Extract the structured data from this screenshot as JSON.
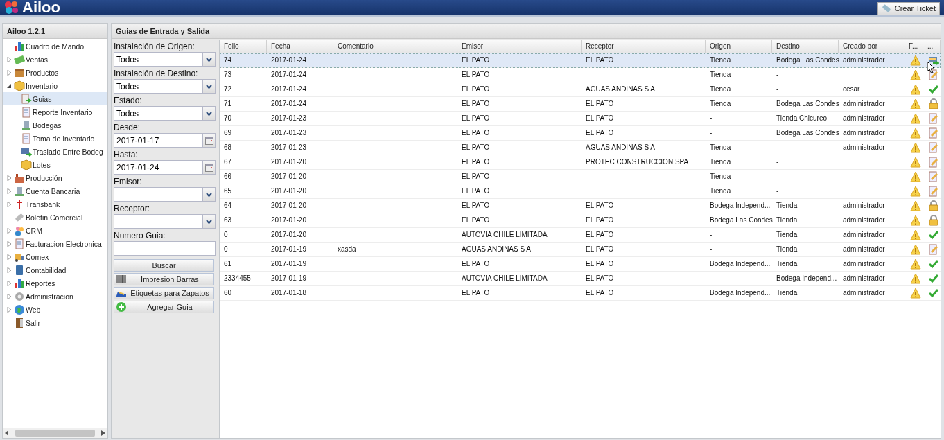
{
  "header": {
    "logo": "Ailoo",
    "ticket_button": "Crear Ticket"
  },
  "sidebar": {
    "title": "Ailoo 1.2.1",
    "items": [
      {
        "label": "Cuadro de Mando",
        "selected": false
      },
      {
        "label": "Ventas",
        "expanded": false,
        "selected": false
      },
      {
        "label": "Productos",
        "expanded": false,
        "selected": false
      },
      {
        "label": "Inventario",
        "expanded": true,
        "selected": false,
        "children": [
          {
            "label": "Guias",
            "selected": true
          },
          {
            "label": "Reporte Inventario",
            "selected": false
          },
          {
            "label": "Bodegas",
            "selected": false
          },
          {
            "label": "Toma de Inventario",
            "selected": false
          },
          {
            "label": "Traslado Entre Bodeg",
            "selected": false
          },
          {
            "label": "Lotes",
            "selected": false
          }
        ]
      },
      {
        "label": "Producción",
        "expanded": false,
        "selected": false
      },
      {
        "label": "Cuenta Bancaria",
        "expanded": false,
        "selected": false
      },
      {
        "label": "Transbank",
        "expanded": false,
        "selected": false
      },
      {
        "label": "Boletin Comercial",
        "selected": false
      },
      {
        "label": "CRM",
        "expanded": false,
        "selected": false
      },
      {
        "label": "Facturacion Electronica",
        "expanded": false,
        "selected": false
      },
      {
        "label": "Comex",
        "expanded": false,
        "selected": false
      },
      {
        "label": "Contabilidad",
        "expanded": false,
        "selected": false
      },
      {
        "label": "Reportes",
        "expanded": false,
        "selected": false
      },
      {
        "label": "Administracion",
        "expanded": false,
        "selected": false
      },
      {
        "label": "Web",
        "expanded": false,
        "selected": false
      },
      {
        "label": "Salir",
        "selected": false
      }
    ]
  },
  "main": {
    "title": "Guias de Entrada y Salida",
    "filters": [
      {
        "label": "Instalación de Origen:",
        "kind": "select",
        "value": "Todos"
      },
      {
        "label": "Instalación de Destino:",
        "kind": "select",
        "value": "Todos"
      },
      {
        "label": "Estado:",
        "kind": "select",
        "value": "Todos"
      },
      {
        "label": "Desde:",
        "kind": "date",
        "value": "2017-01-17"
      },
      {
        "label": "Hasta:",
        "kind": "date",
        "value": "2017-01-24"
      },
      {
        "label": "Emisor:",
        "kind": "select"
      },
      {
        "label": "Receptor:",
        "kind": "select"
      },
      {
        "label": "Numero Guia:",
        "kind": "text"
      }
    ],
    "buttons": [
      "Buscar",
      "Impresion Barras",
      "Etiquetas para Zapatos",
      "Agregar Guia"
    ],
    "table": {
      "columns": [
        "Folio",
        "Fecha",
        "Comentario",
        "Emisor",
        "Receptor",
        "Origen",
        "Destino",
        "Creado por",
        "F...",
        "..."
      ],
      "rows": [
        {
          "selected": true,
          "cells": [
            "74",
            "2017-01-24",
            "",
            "EL PATO",
            "EL PATO",
            "Tienda",
            "Bodega Las Condes",
            "administrador"
          ],
          "kind": "transfer"
        },
        {
          "selected": false,
          "cells": [
            "73",
            "2017-01-24",
            "",
            "EL PATO",
            "",
            "Tienda",
            "-",
            ""
          ],
          "kind": "edit"
        },
        {
          "selected": false,
          "cells": [
            "72",
            "2017-01-24",
            "",
            "EL PATO",
            "AGUAS ANDINAS S A",
            "Tienda",
            "-",
            "cesar"
          ],
          "kind": "check"
        },
        {
          "selected": false,
          "cells": [
            "71",
            "2017-01-24",
            "",
            "EL PATO",
            "EL PATO",
            "Tienda",
            "Bodega Las Condes",
            "administrador"
          ],
          "kind": "lock"
        },
        {
          "selected": false,
          "cells": [
            "70",
            "2017-01-23",
            "",
            "EL PATO",
            "EL PATO",
            "-",
            "Tienda Chicureo",
            "administrador"
          ],
          "kind": "edit"
        },
        {
          "selected": false,
          "cells": [
            "69",
            "2017-01-23",
            "",
            "EL PATO",
            "EL PATO",
            "-",
            "Bodega Las Condes",
            "administrador"
          ],
          "kind": "edit"
        },
        {
          "selected": false,
          "cells": [
            "68",
            "2017-01-23",
            "",
            "EL PATO",
            "AGUAS ANDINAS S A",
            "Tienda",
            "-",
            "administrador"
          ],
          "kind": "edit"
        },
        {
          "selected": false,
          "cells": [
            "67",
            "2017-01-20",
            "",
            "EL PATO",
            "PROTEC CONSTRUCCION SPA",
            "Tienda",
            "-",
            ""
          ],
          "kind": "edit"
        },
        {
          "selected": false,
          "cells": [
            "66",
            "2017-01-20",
            "",
            "EL PATO",
            "",
            "Tienda",
            "-",
            ""
          ],
          "kind": "edit"
        },
        {
          "selected": false,
          "cells": [
            "65",
            "2017-01-20",
            "",
            "EL PATO",
            "",
            "Tienda",
            "-",
            ""
          ],
          "kind": "edit"
        },
        {
          "selected": false,
          "cells": [
            "64",
            "2017-01-20",
            "",
            "EL PATO",
            "EL PATO",
            "Bodega Independ...",
            "Tienda",
            "administrador"
          ],
          "kind": "lock"
        },
        {
          "selected": false,
          "cells": [
            "63",
            "2017-01-20",
            "",
            "EL PATO",
            "EL PATO",
            "Bodega Las Condes",
            "Tienda",
            "administrador"
          ],
          "kind": "lock"
        },
        {
          "selected": false,
          "cells": [
            "0",
            "2017-01-20",
            "",
            "AUTOVIA CHILE LIMITADA",
            "EL PATO",
            "-",
            "Tienda",
            "administrador"
          ],
          "kind": "check"
        },
        {
          "selected": false,
          "cells": [
            "0",
            "2017-01-19",
            "xasda",
            "AGUAS ANDINAS S A",
            "EL PATO",
            "-",
            "Tienda",
            "administrador"
          ],
          "kind": "edit"
        },
        {
          "selected": false,
          "cells": [
            "61",
            "2017-01-19",
            "",
            "EL PATO",
            "EL PATO",
            "Bodega Independ...",
            "Tienda",
            "administrador"
          ],
          "kind": "check"
        },
        {
          "selected": false,
          "cells": [
            "2334455",
            "2017-01-19",
            "",
            "AUTOVIA CHILE LIMITADA",
            "EL PATO",
            "-",
            "Bodega Independ...",
            "administrador"
          ],
          "kind": "check"
        },
        {
          "selected": false,
          "cells": [
            "60",
            "2017-01-18",
            "",
            "EL PATO",
            "EL PATO",
            "Bodega Independ...",
            "Tienda",
            "administrador"
          ],
          "kind": "check"
        }
      ]
    }
  }
}
